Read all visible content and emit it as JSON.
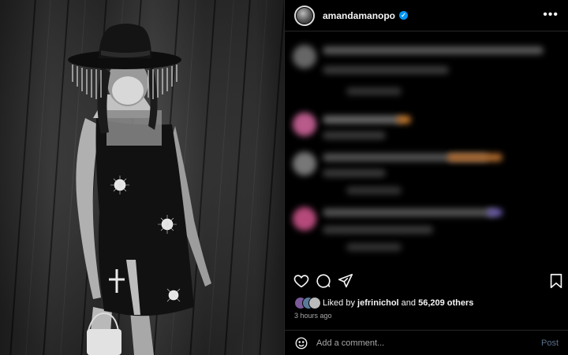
{
  "post": {
    "username": "amandamanopo",
    "verified": true,
    "more_icon": "more-horizontal-icon",
    "liked_by_prefix": "Liked by",
    "liked_by_user": "jefrinichol",
    "liked_by_and": "and",
    "liked_by_count": "56,209 others",
    "timestamp": "3 hours ago"
  },
  "actions": {
    "like_icon": "heart-icon",
    "comment_icon": "comment-icon",
    "share_icon": "send-icon",
    "save_icon": "bookmark-icon"
  },
  "comment_box": {
    "placeholder": "Add a comment...",
    "post_label": "Post",
    "emoji_icon": "emoji-icon"
  },
  "colors": {
    "background": "#000000",
    "text": "#f5f5f5",
    "muted": "#a8a8a8",
    "verified": "#0095f6",
    "post_button_disabled": "#5a6f8a"
  }
}
